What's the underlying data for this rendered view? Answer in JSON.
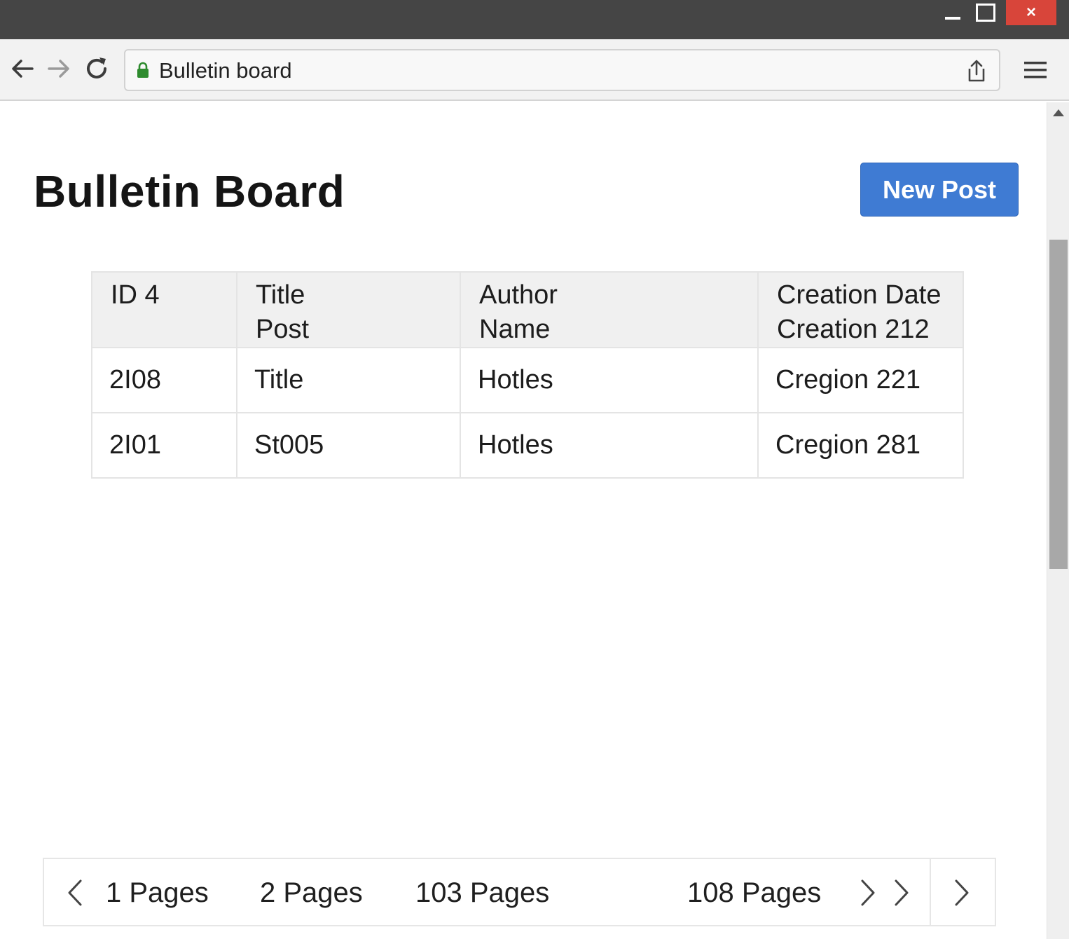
{
  "browser": {
    "url": "Bulletin board",
    "icons": {
      "back": "arrow-left-icon",
      "forward": "arrow-right-icon",
      "reload": "reload-icon",
      "lock": "lock-icon",
      "share": "share-icon",
      "menu": "hamburger-menu-icon",
      "close": "×"
    }
  },
  "page": {
    "title": "Bulletin Board",
    "new_post_label": "New Post",
    "accent_color": "#3f7bd3"
  },
  "table": {
    "headers": [
      [
        "ID 4"
      ],
      [
        "Title",
        "Post"
      ],
      [
        "Author",
        "Name"
      ],
      [
        "Creation Date",
        "Creation 212"
      ]
    ],
    "rows": [
      [
        "2I08",
        "Title",
        "Hotles",
        "Cregion 221"
      ],
      [
        "2I01",
        "St005",
        "Hotles",
        "Cregion 281"
      ]
    ]
  },
  "pagination": {
    "pages": [
      "1 Pages",
      "2 Pages",
      "103 Pages",
      "108 Pages"
    ]
  }
}
